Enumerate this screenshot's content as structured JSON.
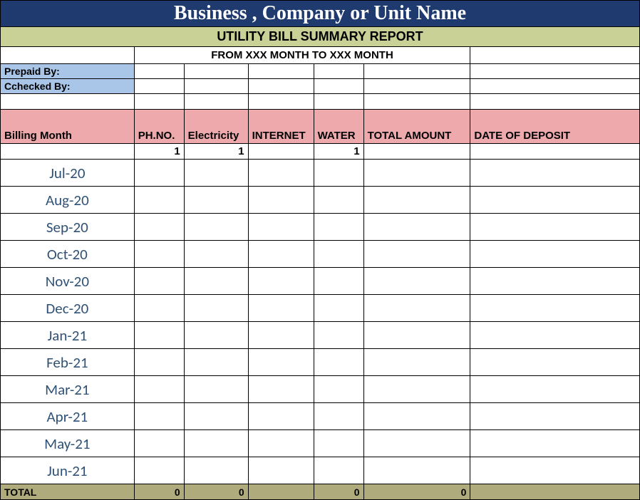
{
  "title": "Business , Company or Unit Name",
  "subtitle": "UTILITY BILL SUMMARY REPORT",
  "date_range": "FROM XXX MONTH  TO XXX MONTH",
  "meta": {
    "prepaid_by_label": "Prepaid By:",
    "checked_by_label": "Cchecked By:",
    "prepaid_by_value": "",
    "checked_by_value": ""
  },
  "columns": {
    "billing_month": "Billing Month",
    "phno": "PH.NO.",
    "electricity": "Electricity",
    "internet": "INTERNET",
    "water": "WATER",
    "total_amount": "TOTAL AMOUNT",
    "date_of_deposit": "DATE OF DEPOSIT"
  },
  "initial": {
    "phno": "1",
    "electricity": "1",
    "internet": "",
    "water": "1",
    "total_amount": "",
    "date_of_deposit": ""
  },
  "rows": [
    {
      "month": "Jul-20",
      "phno": "",
      "electricity": "",
      "internet": "",
      "water": "",
      "total_amount": "",
      "date_of_deposit": ""
    },
    {
      "month": "Aug-20",
      "phno": "",
      "electricity": "",
      "internet": "",
      "water": "",
      "total_amount": "",
      "date_of_deposit": ""
    },
    {
      "month": "Sep-20",
      "phno": "",
      "electricity": "",
      "internet": "",
      "water": "",
      "total_amount": "",
      "date_of_deposit": ""
    },
    {
      "month": "Oct-20",
      "phno": "",
      "electricity": "",
      "internet": "",
      "water": "",
      "total_amount": "",
      "date_of_deposit": ""
    },
    {
      "month": "Nov-20",
      "phno": "",
      "electricity": "",
      "internet": "",
      "water": "",
      "total_amount": "",
      "date_of_deposit": ""
    },
    {
      "month": "Dec-20",
      "phno": "",
      "electricity": "",
      "internet": "",
      "water": "",
      "total_amount": "",
      "date_of_deposit": ""
    },
    {
      "month": "Jan-21",
      "phno": "",
      "electricity": "",
      "internet": "",
      "water": "",
      "total_amount": "",
      "date_of_deposit": ""
    },
    {
      "month": "Feb-21",
      "phno": "",
      "electricity": "",
      "internet": "",
      "water": "",
      "total_amount": "",
      "date_of_deposit": ""
    },
    {
      "month": "Mar-21",
      "phno": "",
      "electricity": "",
      "internet": "",
      "water": "",
      "total_amount": "",
      "date_of_deposit": ""
    },
    {
      "month": "Apr-21",
      "phno": "",
      "electricity": "",
      "internet": "",
      "water": "",
      "total_amount": "",
      "date_of_deposit": ""
    },
    {
      "month": "May-21",
      "phno": "",
      "electricity": "",
      "internet": "",
      "water": "",
      "total_amount": "",
      "date_of_deposit": ""
    },
    {
      "month": "Jun-21",
      "phno": "",
      "electricity": "",
      "internet": "",
      "water": "",
      "total_amount": "",
      "date_of_deposit": ""
    }
  ],
  "totals": {
    "label": "TOTAL",
    "phno": "0",
    "electricity": "0",
    "internet": "",
    "water": "0",
    "total_amount": "0",
    "date_of_deposit": ""
  },
  "chart_data": {
    "type": "table",
    "title": "UTILITY BILL SUMMARY REPORT",
    "columns": [
      "Billing Month",
      "PH.NO.",
      "Electricity",
      "INTERNET",
      "WATER",
      "TOTAL AMOUNT",
      "DATE OF DEPOSIT"
    ],
    "rows": [
      [
        "Jul-20",
        "",
        "",
        "",
        "",
        "",
        ""
      ],
      [
        "Aug-20",
        "",
        "",
        "",
        "",
        "",
        ""
      ],
      [
        "Sep-20",
        "",
        "",
        "",
        "",
        "",
        ""
      ],
      [
        "Oct-20",
        "",
        "",
        "",
        "",
        "",
        ""
      ],
      [
        "Nov-20",
        "",
        "",
        "",
        "",
        "",
        ""
      ],
      [
        "Dec-20",
        "",
        "",
        "",
        "",
        "",
        ""
      ],
      [
        "Jan-21",
        "",
        "",
        "",
        "",
        "",
        ""
      ],
      [
        "Feb-21",
        "",
        "",
        "",
        "",
        "",
        ""
      ],
      [
        "Mar-21",
        "",
        "",
        "",
        "",
        "",
        ""
      ],
      [
        "Apr-21",
        "",
        "",
        "",
        "",
        "",
        ""
      ],
      [
        "May-21",
        "",
        "",
        "",
        "",
        "",
        ""
      ],
      [
        "Jun-21",
        "",
        "",
        "",
        "",
        "",
        ""
      ]
    ],
    "totals": [
      "TOTAL",
      "0",
      "0",
      "",
      "0",
      "0",
      ""
    ]
  }
}
